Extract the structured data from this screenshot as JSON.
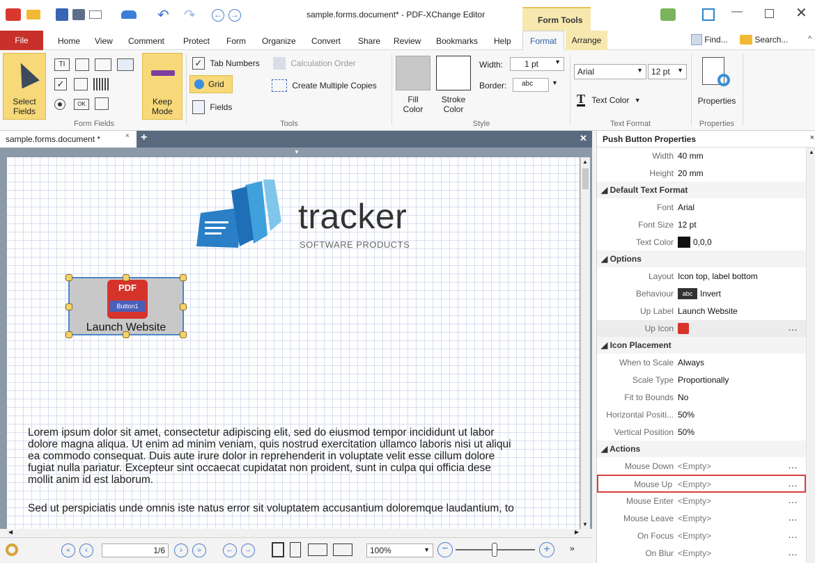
{
  "window": {
    "title": "sample.forms.document* - PDF-XChange Editor",
    "context_tab": "Form Tools"
  },
  "menu_tabs": [
    "File",
    "Home",
    "View",
    "Comment",
    "Protect",
    "Form",
    "Organize",
    "Convert",
    "Share",
    "Review",
    "Bookmarks",
    "Help",
    "Format",
    "Arrange"
  ],
  "quick_actions": {
    "find": "Find...",
    "search": "Search..."
  },
  "ribbon": {
    "form_fields": {
      "select_label_1": "Select",
      "select_label_2": "Fields",
      "keep_label_1": "Keep",
      "keep_label_2": "Mode",
      "group": "Form Fields"
    },
    "tools": {
      "tab_numbers": "Tab Numbers",
      "calculation_order": "Calculation Order",
      "grid": "Grid",
      "create_multiple_copies": "Create Multiple Copies",
      "fields": "Fields",
      "group": "Tools"
    },
    "style": {
      "fill_1": "Fill",
      "fill_2": "Color",
      "stroke_1": "Stroke",
      "stroke_2": "Color",
      "width_label": "Width:",
      "width_value": "1 pt",
      "border_label": "Border:",
      "border_value": "abc",
      "group": "Style"
    },
    "text_format": {
      "font": "Arial",
      "size": "12 pt",
      "text_color": "Text Color",
      "group": "Text Format"
    },
    "properties": {
      "button": "Properties",
      "group": "Properties"
    }
  },
  "document": {
    "tab_title": "sample.forms.document *",
    "logo_word": "tracker",
    "logo_sub": "SOFTWARE PRODUCTS",
    "button_icon_top": "PDF",
    "button_icon_bottom": "Button1",
    "button_label": "Launch Website",
    "paragraph1": [
      "Lorem ipsum dolor sit amet, consectetur adipiscing elit, sed do eiusmod tempor incididunt ut labor",
      "dolore magna aliqua. Ut enim ad minim veniam, quis nostrud exercitation ullamco laboris nisi ut aliqui",
      "ea commodo consequat. Duis aute irure dolor in reprehenderit in voluptate velit esse cillum dolore",
      "fugiat nulla pariatur. Excepteur sint occaecat cupidatat non proident, sunt in culpa qui officia dese",
      "mollit anim id est laborum."
    ],
    "paragraph2": "Sed ut perspiciatis unde omnis iste natus error sit voluptatem accusantium doloremque laudantium, to"
  },
  "statusbar": {
    "page": "1/6",
    "zoom": "100%"
  },
  "properties_pane": {
    "title": "Push Button Properties",
    "rows": {
      "width": {
        "label": "Width",
        "value": "40 mm"
      },
      "height": {
        "label": "Height",
        "value": "20 mm"
      },
      "default_text_format": "Default Text Format",
      "font": {
        "label": "Font",
        "value": "Arial"
      },
      "font_size": {
        "label": "Font Size",
        "value": "12 pt"
      },
      "text_color": {
        "label": "Text Color",
        "value": "0,0,0"
      },
      "options": "Options",
      "layout": {
        "label": "Layout",
        "value": "Icon top, label bottom"
      },
      "behaviour": {
        "label": "Behaviour",
        "chip": "abc",
        "value": "Invert"
      },
      "up_label": {
        "label": "Up Label",
        "value": "Launch Website"
      },
      "up_icon": {
        "label": "Up Icon"
      },
      "icon_placement": "Icon Placement",
      "when_to_scale": {
        "label": "When to Scale",
        "value": "Always"
      },
      "scale_type": {
        "label": "Scale Type",
        "value": "Proportionally"
      },
      "fit_to_bounds": {
        "label": "Fit to Bounds",
        "value": "No"
      },
      "horizontal_position": {
        "label": "Horizontal Positi...",
        "value": "50%"
      },
      "vertical_position": {
        "label": "Vertical Position",
        "value": "50%"
      },
      "actions": "Actions",
      "mouse_down": {
        "label": "Mouse Down",
        "value": "<Empty>"
      },
      "mouse_up": {
        "label": "Mouse Up",
        "value": "<Empty>"
      },
      "mouse_enter": {
        "label": "Mouse Enter",
        "value": "<Empty>"
      },
      "mouse_leave": {
        "label": "Mouse Leave",
        "value": "<Empty>"
      },
      "on_focus": {
        "label": "On Focus",
        "value": "<Empty>"
      },
      "on_blur": {
        "label": "On Blur",
        "value": "<Empty>"
      }
    }
  },
  "colors": {
    "accent": "#c8312b",
    "context_tab_bg": "#f7e8b0",
    "doc_tab_bg": "#5a6a7e",
    "highlight_border": "#d64040"
  }
}
